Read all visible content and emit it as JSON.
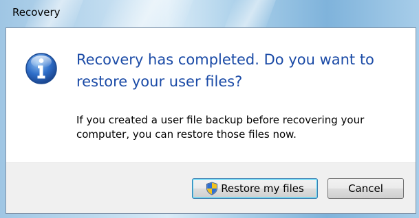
{
  "window": {
    "title": "Recovery"
  },
  "dialog": {
    "main_instruction": "Recovery has completed. Do you want to restore your user files?",
    "content": "If you created a user file backup before recovering your computer, you can restore those files now.",
    "icon": "info-icon"
  },
  "buttons": {
    "restore_label": "Restore my files",
    "restore_icon": "shield-icon",
    "cancel_label": "Cancel"
  },
  "colors": {
    "instruction_text": "#1a4aa6",
    "info_icon": "#2f6ec8",
    "footer_background": "#f0f0f0"
  }
}
